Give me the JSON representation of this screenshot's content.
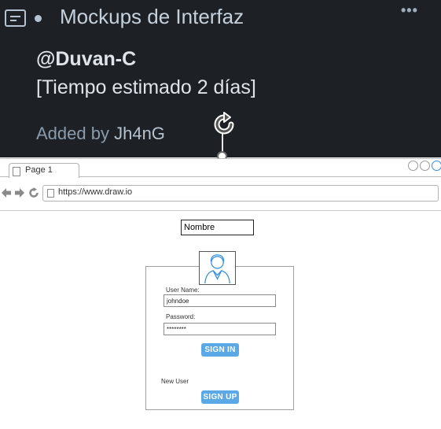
{
  "card": {
    "title": "Mockups de Interfaz",
    "more": "•••",
    "line1": "@Duvan-C",
    "line2": "[Tiempo estimado 2 días]",
    "added_label": "Added by",
    "added_user": "Jh4nG",
    "description_icon": "description-icon",
    "rotate_icon": "rotate-icon"
  },
  "browser": {
    "tab_label": "Page 1",
    "url": "https://www.draw.io",
    "nav_icons": [
      "back-arrow-icon",
      "forward-arrow-icon",
      "refresh-icon"
    ]
  },
  "form": {
    "name_field": "Nombre",
    "username_label": "User Name:",
    "username_value": "johndoe",
    "password_label": "Password:",
    "password_value": "********",
    "sign_in": "SIGN IN",
    "new_user": "New User",
    "sign_up": "SIGN UP"
  },
  "colors": {
    "card_bg": "#1d2125",
    "button": "#5aa9e6",
    "accent_window_btn": "#2f8de0"
  }
}
